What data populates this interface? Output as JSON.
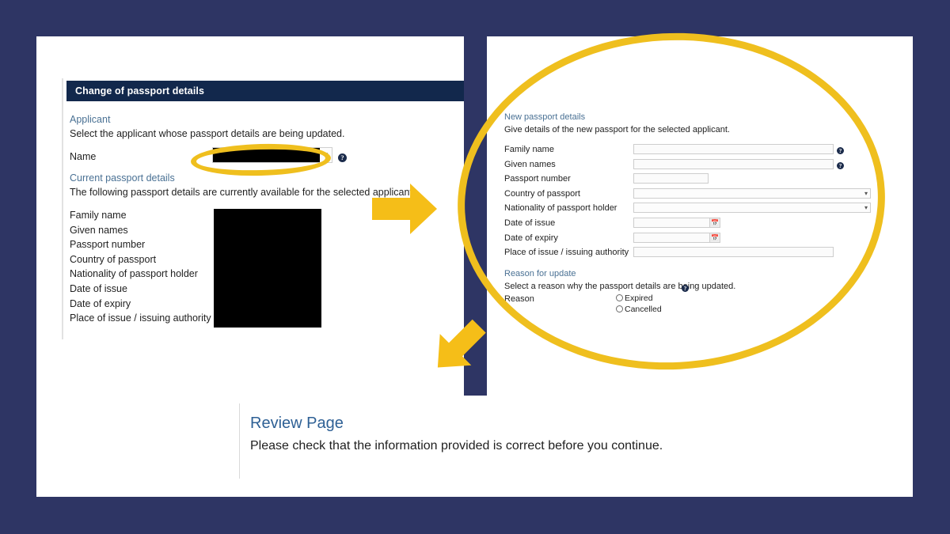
{
  "theme": {
    "background": "#2E3564",
    "page_background": "#FFFFFF",
    "header_bar": "#12284C",
    "section_heading": "#4A7194",
    "annotation_yellow": "#EFBF1E",
    "review_title": "#2E6095"
  },
  "left_page": {
    "header_title": "Change of passport details",
    "applicant_section": {
      "heading": "Applicant",
      "description": "Select the applicant whose passport details are being updated.",
      "name_label": "Name",
      "name_value": "",
      "name_help_icon": "help-icon",
      "dropdown_chevron_icon": "chevron-down-icon",
      "redacted": true
    },
    "current_section": {
      "heading": "Current passport details",
      "description": "The following passport details are currently available for the selected applicant.",
      "fields": [
        "Family name",
        "Given names",
        "Passport number",
        "Country of passport",
        "Nationality of passport holder",
        "Date of issue",
        "Date of expiry",
        "Place of issue / issuing authority"
      ],
      "values_redacted": true
    }
  },
  "right_page": {
    "new_section": {
      "heading": "New passport details",
      "description": "Give details of the new passport for the selected applicant.",
      "fields": [
        {
          "label": "Family name",
          "value": "",
          "control": "text",
          "help": true
        },
        {
          "label": "Given names",
          "value": "",
          "control": "text",
          "help": true
        },
        {
          "label": "Passport number",
          "value": "",
          "control": "text-short",
          "help": false
        },
        {
          "label": "Country of passport",
          "value": "",
          "control": "select",
          "help": false
        },
        {
          "label": "Nationality of passport holder",
          "value": "",
          "control": "select",
          "help": false
        },
        {
          "label": "Date of issue",
          "value": "",
          "control": "date",
          "help": false
        },
        {
          "label": "Date of expiry",
          "value": "",
          "control": "date",
          "help": false
        },
        {
          "label": "Place of issue / issuing authority",
          "value": "",
          "control": "text",
          "help": false
        }
      ],
      "calendar_icon": "calendar-icon",
      "select_chevron_icon": "chevron-down-icon",
      "help_icon": "help-icon"
    },
    "reason_section": {
      "heading": "Reason for update",
      "description": "Select a reason why the passport details are being updated.",
      "help_icon": "help-icon",
      "field_label": "Reason",
      "options": [
        {
          "label": "Expired",
          "selected": false
        },
        {
          "label": "Cancelled",
          "selected": false
        }
      ]
    }
  },
  "review_panel": {
    "title": "Review Page",
    "subtitle": "Please check that the information provided is correct before you continue."
  },
  "annotations": {
    "ellipse_name_field": "highlight-ellipse",
    "ellipse_new_details": "highlight-ellipse",
    "arrow_right": "arrow-right-icon",
    "arrow_down_left": "arrow-down-left-icon"
  }
}
